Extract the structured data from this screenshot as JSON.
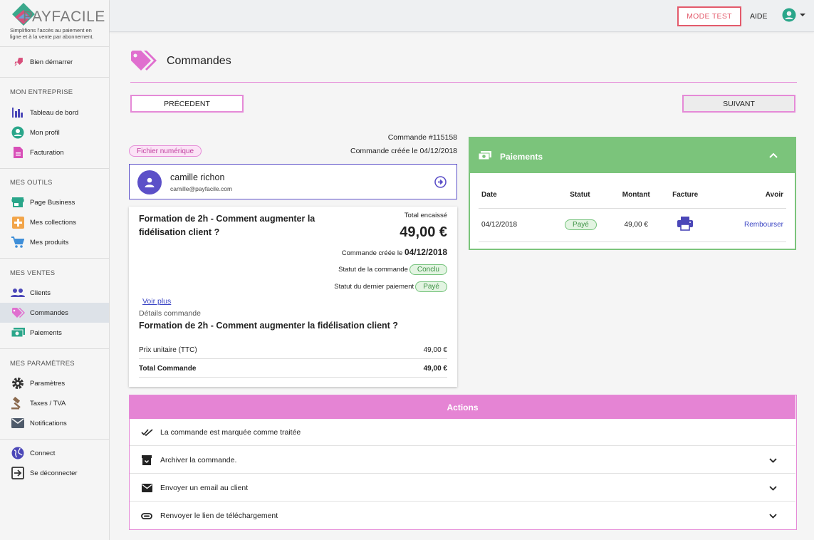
{
  "brand": {
    "name": "PAYFACILE",
    "tagline": "Simplifions l'accès au paiement en ligne et à la vente par abonnement.",
    "colors": {
      "pink": "#e58ad7",
      "green": "#7bc47b",
      "purple": "#5c50c8",
      "red": "#e35a6b"
    }
  },
  "sidebar": {
    "start": {
      "label": "Bien démarrer",
      "icon": "rocket-icon"
    },
    "sections": [
      {
        "title": "MON ENTREPRISE",
        "items": [
          {
            "label": "Tableau de bord",
            "icon": "bar-chart-icon"
          },
          {
            "label": "Mon profil",
            "icon": "profile-icon"
          },
          {
            "label": "Facturation",
            "icon": "document-icon"
          }
        ]
      },
      {
        "title": "MES OUTILS",
        "items": [
          {
            "label": "Page Business",
            "icon": "store-icon"
          },
          {
            "label": "Mes collections",
            "icon": "collection-icon"
          },
          {
            "label": "Mes produits",
            "icon": "cart-icon"
          }
        ]
      },
      {
        "title": "MES VENTES",
        "items": [
          {
            "label": "Clients",
            "icon": "people-icon"
          },
          {
            "label": "Commandes",
            "icon": "tag-icon",
            "active": true
          },
          {
            "label": "Paiements",
            "icon": "money-icon"
          }
        ]
      },
      {
        "title": "MES PARAMÈTRES",
        "items": [
          {
            "label": "Paramètres",
            "icon": "gear-icon"
          },
          {
            "label": "Taxes / TVA",
            "icon": "gavel-icon"
          },
          {
            "label": "Notifications",
            "icon": "mail-icon"
          }
        ]
      }
    ],
    "footer": [
      {
        "label": "Connect",
        "icon": "globe-icon"
      },
      {
        "label": "Se déconnecter",
        "icon": "logout-icon"
      }
    ]
  },
  "topbar": {
    "mode_test": "MODE TEST",
    "aide": "AIDE",
    "user_icon": "account-circle-icon"
  },
  "page": {
    "title": "Commandes",
    "icon": "tags-icon"
  },
  "nav": {
    "prev": "PRÉCEDENT",
    "next": "SUIVANT"
  },
  "order": {
    "number": "Commande #115158",
    "created": "Commande créée le 04/12/2018",
    "chip": "Fichier numérique",
    "client": {
      "name": "camille richon",
      "email": "camille@payfacile.com"
    },
    "product": "Formation de 2h - Comment augmenter la fidélisation client ?",
    "total_label": "Total encaissé",
    "total": "49,00 €",
    "created_label": "Commande créée le",
    "created_date": "04/12/2018",
    "status_label": "Statut de la commande",
    "status": "Conclu",
    "last_payment_label": "Statut du dernier paiement",
    "last_payment": "Payé",
    "see_more": "Voir plus",
    "details_label": "Détails commande",
    "details_product": "Formation de 2h - Comment augmenter la fidélisation client ?",
    "unit_label": "Prix unitaire (TTC)",
    "unit_price": "49,00 €",
    "total_order_label": "Total Commande",
    "total_order": "49,00 €"
  },
  "payments": {
    "title": "Paiements",
    "headers": [
      "Date",
      "Statut",
      "Montant",
      "Facture",
      "Avoir"
    ],
    "rows": [
      {
        "date": "04/12/2018",
        "status": "Payé",
        "amount": "49,00 €",
        "invoice_icon": "print-icon",
        "credit": "Rembourser"
      }
    ]
  },
  "actions": {
    "title": "Actions",
    "items": [
      {
        "label": "La commande est marquée comme traitée",
        "icon": "double-check-icon"
      },
      {
        "label": "Archiver la commande.",
        "icon": "archive-icon"
      },
      {
        "label": "Envoyer un email au client",
        "icon": "email-icon"
      },
      {
        "label": "Renvoyer le lien de téléchargement",
        "icon": "attach-icon"
      }
    ]
  }
}
